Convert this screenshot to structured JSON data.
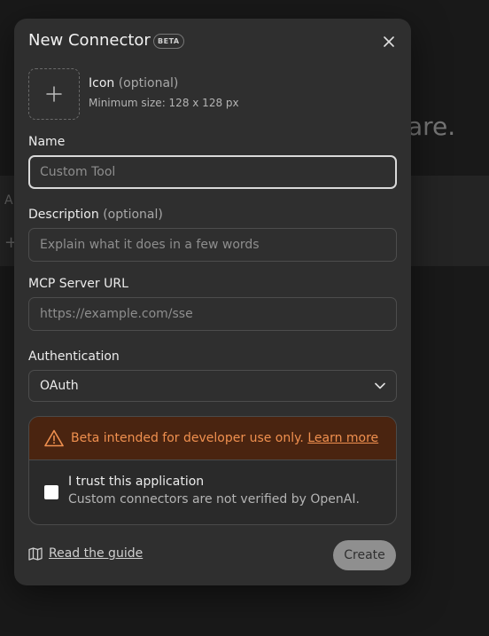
{
  "background": {
    "headline_fragment": "are.",
    "panel_letter": "A",
    "panel_icon": "plus-icon"
  },
  "modal": {
    "title": "New Connector",
    "badge": "BETA",
    "close_icon": "close-icon"
  },
  "icon_field": {
    "label": "Icon",
    "optional": "(optional)",
    "hint": "Minimum size: 128 x 128 px"
  },
  "name_field": {
    "label": "Name",
    "placeholder": "Custom Tool",
    "value": ""
  },
  "description_field": {
    "label": "Description",
    "optional": "(optional)",
    "placeholder": "Explain what it does in a few words",
    "value": ""
  },
  "url_field": {
    "label": "MCP Server URL",
    "placeholder": "https://example.com/sse",
    "value": ""
  },
  "auth_field": {
    "label": "Authentication",
    "selected": "OAuth"
  },
  "warning": {
    "text": "Beta intended for developer use only.",
    "link": "Learn more",
    "accent_color": "#f0904f"
  },
  "trust": {
    "title": "I trust this application",
    "subtitle": "Custom connectors are not verified by OpenAI.",
    "checked": false
  },
  "footer": {
    "guide_label": "Read the guide",
    "create_label": "Create"
  }
}
